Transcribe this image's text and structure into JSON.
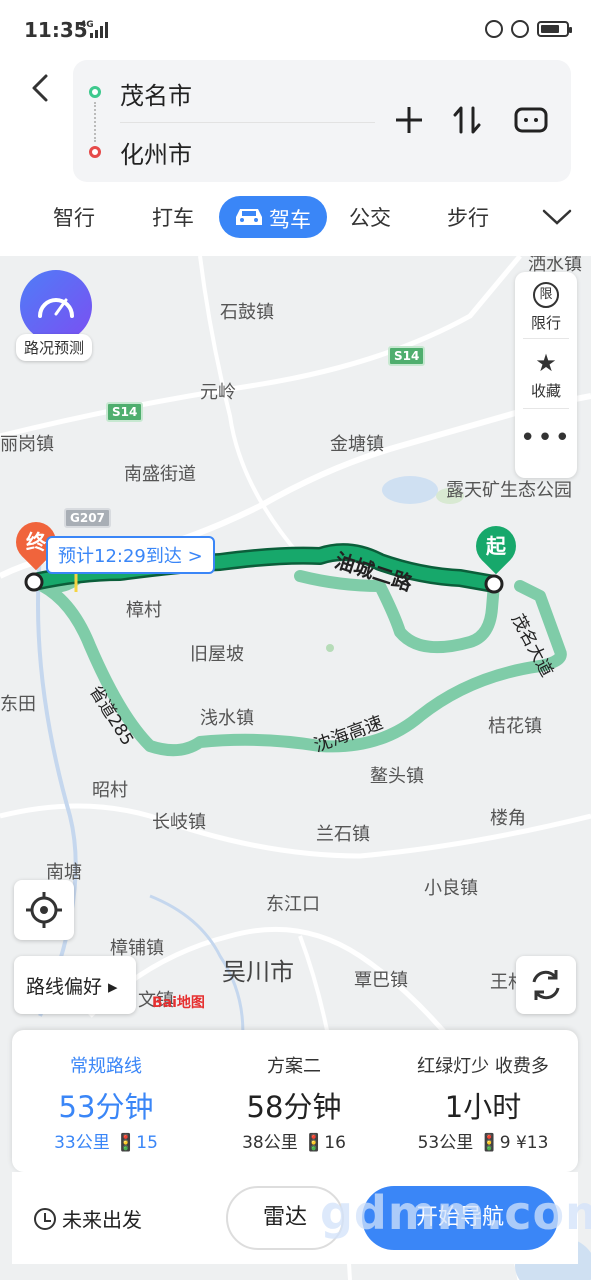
{
  "status_bar": {
    "time": "11:35",
    "network": "4G"
  },
  "search": {
    "from": "茂名市",
    "to": "化州市"
  },
  "tabs": [
    {
      "label": "智行"
    },
    {
      "label": "打车"
    },
    {
      "label": "驾车",
      "active": true
    },
    {
      "label": "公交"
    },
    {
      "label": "步行"
    }
  ],
  "map": {
    "traffic_label": "路况预测",
    "side": {
      "limit_icon": "限",
      "limit": "限行",
      "fav": "收藏"
    },
    "places": [
      "洒水镇",
      "石鼓镇",
      "元岭",
      "丽岗镇",
      "金塘镇",
      "南盛街道",
      "露天矿生态公园",
      "樟村",
      "旧屋坡",
      "东田",
      "浅水镇",
      "桔花镇",
      "昭村",
      "鳌头镇",
      "长岐镇",
      "兰石镇",
      "楼角",
      "南塘",
      "小良镇",
      "东江口",
      "樟铺镇",
      "吴川市",
      "覃巴镇",
      "王村",
      "文镇"
    ],
    "shields": [
      "S14",
      "S14",
      "G207"
    ],
    "roads": {
      "r1": "油城二路",
      "r2": "茂名大道",
      "r3": "沈海高速",
      "r4": "省道285"
    },
    "end_marker": "终",
    "start_marker": "起",
    "eta": "预计12:29到达 >",
    "route_pref": "路线偏好",
    "logo": "Bai地图"
  },
  "plans": [
    {
      "name": "常规路线",
      "time": "53分钟",
      "meta": "33公里  🚦15"
    },
    {
      "name": "方案二",
      "time": "58分钟",
      "meta": "38公里  🚦16"
    },
    {
      "name": "红绿灯少  收费多",
      "time": "1小时",
      "meta": "53公里  🚦9  ¥13"
    }
  ],
  "bottom": {
    "future": "未来出发",
    "radar": "雷达",
    "go": "开始导航",
    "watermark": "gdmm.com"
  },
  "colors": {
    "accent": "#3a86f7",
    "route_main": "#17a86b",
    "route_alt": "#7fcca8",
    "start": "#17a86b",
    "end": "#f0643c"
  }
}
